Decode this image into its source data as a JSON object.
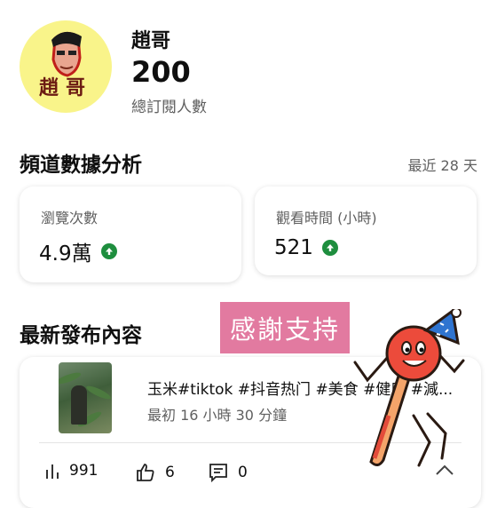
{
  "channel": {
    "avatar_text": "趙哥",
    "name": "趙哥",
    "subscriber_count": "200",
    "subscriber_label": "總訂閱人數"
  },
  "analytics": {
    "title": "頻道數據分析",
    "period": "最近 28 天",
    "views": {
      "label": "瀏覽次數",
      "value": "4.9萬"
    },
    "watch_time": {
      "label": "觀看時間 (小時)",
      "value": "521"
    }
  },
  "latest": {
    "title": "最新發布內容",
    "overlay_text": "感謝支持",
    "video": {
      "title": "玉米#tiktok #抖音热门 #美食 #健康 #減...",
      "time": "最初 16 小時 30 分鐘",
      "views": "991",
      "likes": "6",
      "comments": "0"
    }
  },
  "colors": {
    "avatar_bg": "#f9f48a",
    "up_green": "#1e8e3e",
    "overlay_bg": "#e27aa0"
  },
  "icons": [
    "up-arrow-icon",
    "bar-chart-icon",
    "thumbs-up-icon",
    "comment-icon",
    "chevron-up-icon"
  ]
}
